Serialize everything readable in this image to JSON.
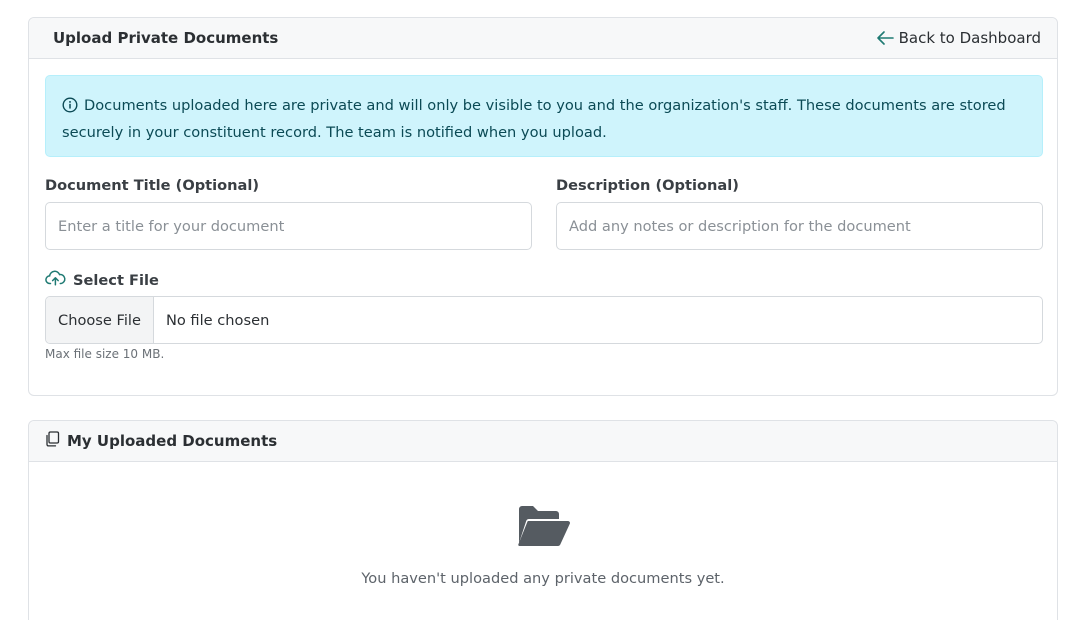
{
  "upload_card": {
    "title": "Upload Private Documents",
    "back_link": "Back to Dashboard",
    "alert_text": "Documents uploaded here are private and will only be visible to you and the organization's staff. These documents are stored securely in your constituent record. The team is notified when you upload.",
    "title_field": {
      "label": "Document Title (Optional)",
      "placeholder": "Enter a title for your document",
      "value": ""
    },
    "description_field": {
      "label": "Description (Optional)",
      "placeholder": "Add any notes or description for the document",
      "value": ""
    },
    "file_field": {
      "label": "Select File",
      "button_label": "Choose File",
      "status": "No file chosen",
      "hint": "Max file size 10 MB."
    }
  },
  "documents_card": {
    "title": "My Uploaded Documents",
    "empty_message": "You haven't uploaded any private documents yet."
  },
  "icons": {
    "back": "arrow-left-icon",
    "info": "info-circle-icon",
    "upload": "cloud-upload-icon",
    "documents": "copy-files-icon",
    "empty": "folder-open-icon"
  },
  "colors": {
    "accent": "#1f7a73",
    "alert_bg": "#cff4fc",
    "alert_text": "#0b4a55",
    "folder": "#555b61"
  }
}
